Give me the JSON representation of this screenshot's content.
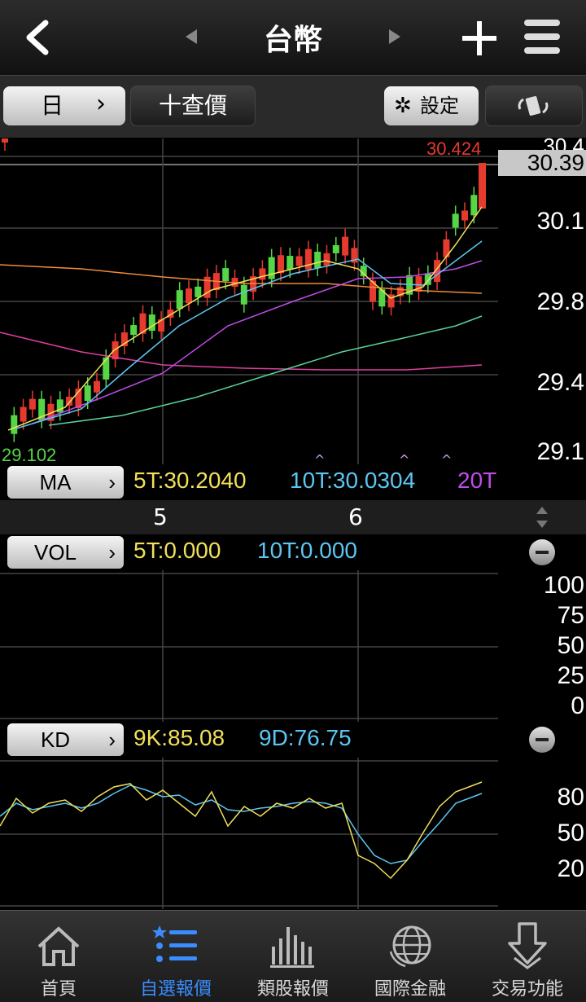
{
  "header": {
    "title": "台幣",
    "back_glyph": "‹",
    "prev_glyph": "◀",
    "next_glyph": "▶"
  },
  "toolbar": {
    "period_label": "日",
    "period_arrow": "›",
    "crosshair_label": "十查價",
    "settings_label": "設定"
  },
  "price_chart": {
    "high_label": "30.424",
    "low_label": "29.102",
    "current_price": "30.39",
    "axis_top_partial": "30.4",
    "axis_labels": [
      "30.1",
      "29.8",
      "29.4",
      "29.1"
    ],
    "x_labels": [
      "5",
      "6"
    ]
  },
  "ma_bar": {
    "button_label": "MA",
    "arrow": "›",
    "ma5": "5T:30.2040",
    "ma10": "10T:30.0304",
    "ma20": "20T",
    "colors": {
      "ma5": "#f2df5a",
      "ma10": "#5cc6f2",
      "ma20": "#c04ce8"
    }
  },
  "vol_bar": {
    "button_label": "VOL",
    "arrow": "›",
    "v5": "5T:0.000",
    "v10": "10T:0.000"
  },
  "vol_axis": [
    "100",
    "75",
    "50",
    "25",
    "0"
  ],
  "kd_bar": {
    "button_label": "KD",
    "arrow": "›",
    "k": "9K:85.08",
    "d": "9D:76.75"
  },
  "kd_axis": [
    "80",
    "50",
    "20"
  ],
  "tabs": [
    {
      "label": "首頁",
      "icon": "home-icon",
      "active": false
    },
    {
      "label": "自選報價",
      "icon": "list-star-icon",
      "active": true
    },
    {
      "label": "類股報價",
      "icon": "bar-chart-icon",
      "active": false
    },
    {
      "label": "國際金融",
      "icon": "globe-icon",
      "active": false
    },
    {
      "label": "交易功能",
      "icon": "arrow-down-icon",
      "active": false
    }
  ],
  "colors": {
    "up": "#e53a2e",
    "down": "#56d646",
    "accent": "#3a8dff"
  }
}
